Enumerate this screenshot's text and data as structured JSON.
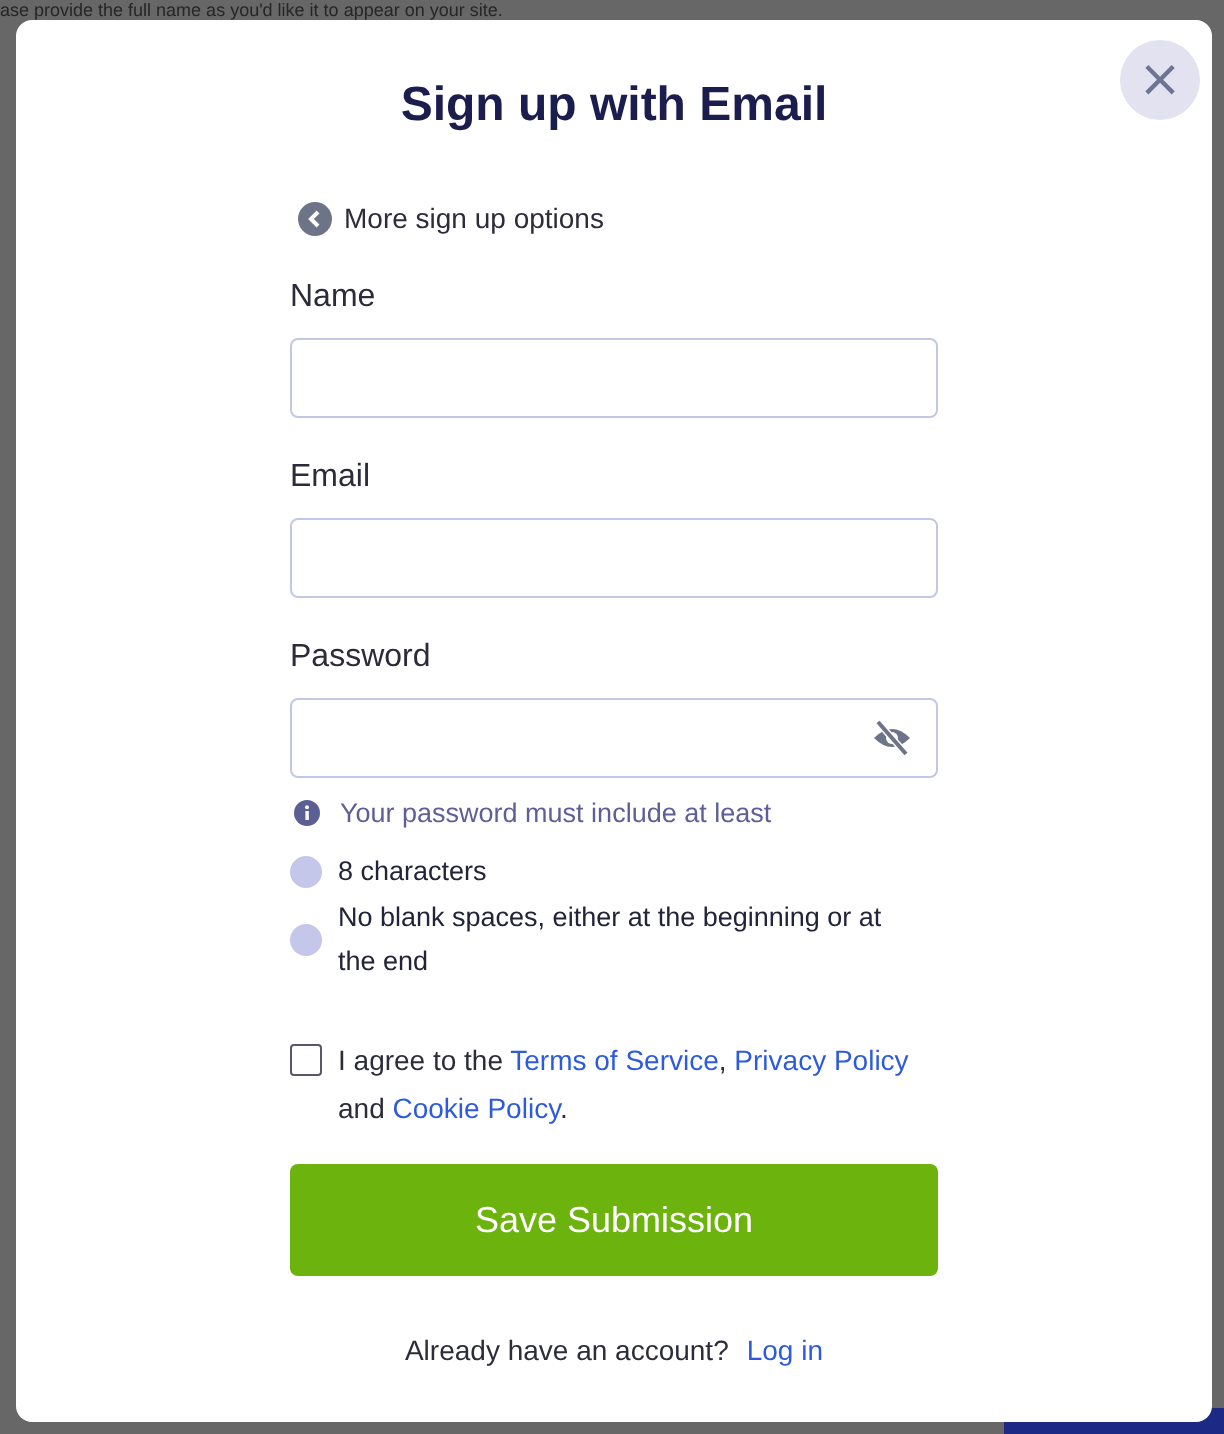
{
  "background_page": {
    "text": "ase provide the full name as you'd like it to appear on your site."
  },
  "dialog": {
    "title": "Sign up with Email",
    "close_label": "×",
    "back_link": "More sign up options",
    "fields": [
      {
        "label": "Name",
        "kind": "text"
      },
      {
        "label": "Email",
        "kind": "text"
      },
      {
        "label": "Password",
        "kind": "password"
      }
    ],
    "password_hint": "Your password must include at least",
    "rules": [
      {
        "text": "8 characters",
        "met": false
      },
      {
        "text": "No blank spaces, either at the beginning or at the end",
        "met": false
      }
    ],
    "agreement": {
      "checked": false,
      "parts": [
        {
          "kind": "text",
          "text": "I agree to the "
        },
        {
          "kind": "link",
          "text": "Terms of Service"
        },
        {
          "kind": "text",
          "text": ", "
        },
        {
          "kind": "link",
          "text": "Privacy Policy"
        },
        {
          "kind": "text",
          "text": " and "
        },
        {
          "kind": "link",
          "text": "Cookie Policy"
        },
        {
          "kind": "text",
          "text": "."
        }
      ]
    },
    "submit_button": "Save Submission",
    "login_prompt": "Already have an account?",
    "login_link": "Log in"
  }
}
